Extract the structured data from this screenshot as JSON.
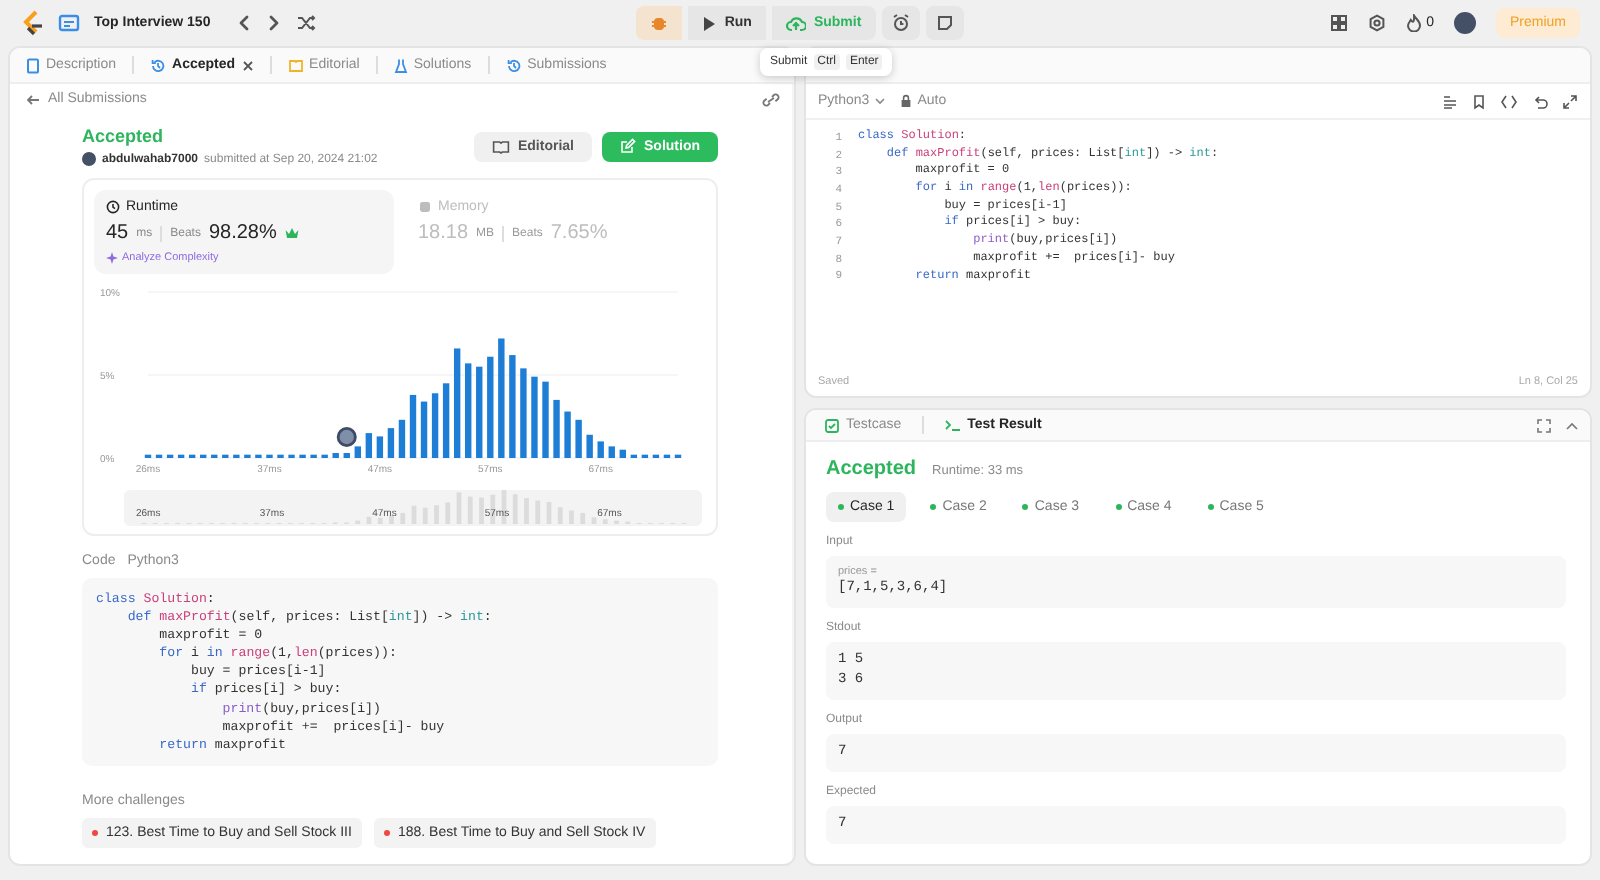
{
  "top_bar": {
    "problem_list_title": "Top Interview 150",
    "run_label": "Run",
    "submit_label": "Submit",
    "streak_count": "0",
    "premium_label": "Premium"
  },
  "submit_tooltip": {
    "label": "Submit",
    "keys": [
      "Ctrl",
      "Enter"
    ]
  },
  "left_tabs": [
    {
      "label": "Description",
      "selected": false,
      "closable": false,
      "kind": "description"
    },
    {
      "label": "Accepted",
      "selected": true,
      "closable": true,
      "kind": "result"
    },
    {
      "label": "Editorial",
      "selected": false,
      "closable": false,
      "kind": "editorial"
    },
    {
      "label": "Solutions",
      "selected": false,
      "closable": false,
      "kind": "solutions"
    },
    {
      "label": "Submissions",
      "selected": false,
      "closable": false,
      "kind": "submissions"
    }
  ],
  "submission": {
    "back_link": "All Submissions",
    "status": "Accepted",
    "username": "abdulwahab7000",
    "submitted_text": "submitted at Sep 20, 2024 21:02",
    "buttons": [
      {
        "label": "Editorial",
        "kind": "secondary"
      },
      {
        "label": "Solution",
        "kind": "primary"
      }
    ],
    "metrics": [
      {
        "title": "Runtime",
        "value": "45",
        "unit": "ms",
        "beats_label": "Beats",
        "beats": "98.28%",
        "selected": true,
        "analyze_link": "Analyze Complexity"
      },
      {
        "title": "Memory",
        "value": "18.18",
        "unit": "MB",
        "beats_label": "Beats",
        "beats": "7.65%",
        "selected": false
      }
    ],
    "chart_data": {
      "type": "bar",
      "ylim": [
        0,
        10
      ],
      "yticks": [
        {
          "value": 0,
          "label": "0%"
        },
        {
          "value": 5,
          "label": "5%"
        },
        {
          "value": 10,
          "label": "10%"
        }
      ],
      "xlim": [
        26,
        74
      ],
      "x": [
        26,
        27,
        28,
        29,
        30,
        31,
        32,
        33,
        34,
        35,
        36,
        37,
        38,
        39,
        40,
        41,
        42,
        43,
        44,
        45,
        46,
        47,
        48,
        49,
        50,
        51,
        52,
        53,
        54,
        55,
        56,
        57,
        58,
        59,
        60,
        61,
        62,
        63,
        64,
        65,
        66,
        67,
        68,
        69,
        70,
        71,
        72,
        73,
        74
      ],
      "xticks": [
        {
          "value": 26,
          "label": "26ms"
        },
        {
          "value": 37,
          "label": "37ms"
        },
        {
          "value": 47,
          "label": "47ms"
        },
        {
          "value": 57,
          "label": "57ms"
        },
        {
          "value": 67,
          "label": "67ms"
        }
      ],
      "series": [
        {
          "color": "#1e7ed6",
          "values": [
            0.2,
            0.2,
            0.2,
            0.2,
            0.2,
            0.2,
            0.2,
            0.2,
            0.2,
            0.2,
            0.2,
            0.2,
            0.2,
            0.2,
            0.2,
            0.2,
            0.2,
            0.3,
            0.3,
            0.7,
            1.5,
            1.3,
            1.8,
            2.3,
            3.8,
            3.4,
            3.9,
            4.5,
            6.6,
            5.7,
            5.5,
            6.1,
            7.2,
            6.2,
            5.4,
            4.9,
            4.6,
            3.5,
            2.8,
            2.3,
            1.4,
            1.0,
            0.7,
            0.5,
            0.2,
            0.2,
            0.2,
            0.2,
            0.2
          ]
        }
      ]
    },
    "navigator_labels": [
      "26ms",
      "37ms",
      "47ms",
      "57ms",
      "67ms"
    ],
    "code_label": "Code",
    "language": "Python3",
    "code": [
      [
        {
          "text": "class",
          "kind": "keyword"
        },
        {
          "text": " Solution",
          "kind": "function"
        },
        {
          "text": ":",
          "kind": "plain"
        }
      ],
      [
        {
          "text": "    def",
          "kind": "keyword"
        },
        {
          "text": " maxProfit",
          "kind": "function"
        },
        {
          "text": "(self, prices: List[",
          "kind": "plain"
        },
        {
          "text": "int",
          "kind": "type"
        },
        {
          "text": "]) -> ",
          "kind": "plain"
        },
        {
          "text": "int",
          "kind": "type"
        },
        {
          "text": ":",
          "kind": "plain"
        }
      ],
      [
        {
          "text": "        maxprofit = 0",
          "kind": "plain"
        }
      ],
      [
        {
          "text": "        for",
          "kind": "keyword"
        },
        {
          "text": " i ",
          "kind": "plain"
        },
        {
          "text": "in",
          "kind": "keyword"
        },
        {
          "text": " range",
          "kind": "function"
        },
        {
          "text": "(1,",
          "kind": "plain"
        },
        {
          "text": "len",
          "kind": "function"
        },
        {
          "text": "(prices)):",
          "kind": "plain"
        }
      ],
      [
        {
          "text": "            buy = prices[i-1]",
          "kind": "plain"
        }
      ],
      [
        {
          "text": "            if",
          "kind": "keyword"
        },
        {
          "text": " prices[i] > buy:",
          "kind": "plain"
        }
      ],
      [
        {
          "text": "                print",
          "kind": "builtin"
        },
        {
          "text": "(buy,prices[i])",
          "kind": "plain"
        }
      ],
      [
        {
          "text": "                maxprofit +=  prices[i]- buy",
          "kind": "plain"
        }
      ],
      [
        {
          "text": "        return",
          "kind": "keyword"
        },
        {
          "text": " maxprofit",
          "kind": "plain"
        }
      ]
    ],
    "more_challenges": {
      "title": "More challenges",
      "items": [
        {
          "label": "123. Best Time to Buy and Sell Stock III",
          "color": "#ef4743"
        },
        {
          "label": "188. Best Time to Buy and Sell Stock IV",
          "color": "#ef4743"
        }
      ]
    }
  },
  "editor": {
    "language": "Python3",
    "autocomplete": "Auto",
    "status": "Saved",
    "cursor": "Ln 8, Col 25",
    "lines": [
      {
        "number": "1",
        "tokens": [
          {
            "text": "class",
            "kind": "keyword"
          },
          {
            "text": " Solution",
            "kind": "function"
          },
          {
            "text": ":",
            "kind": "plain"
          }
        ]
      },
      {
        "number": "2",
        "tokens": [
          {
            "text": "    def",
            "kind": "keyword"
          },
          {
            "text": " maxProfit",
            "kind": "function"
          },
          {
            "text": "(self, prices: List[",
            "kind": "plain"
          },
          {
            "text": "int",
            "kind": "type"
          },
          {
            "text": "]) -> ",
            "kind": "plain"
          },
          {
            "text": "int",
            "kind": "type"
          },
          {
            "text": ":",
            "kind": "plain"
          }
        ]
      },
      {
        "number": "3",
        "tokens": [
          {
            "text": "        maxprofit = 0",
            "kind": "plain"
          }
        ]
      },
      {
        "number": "4",
        "tokens": [
          {
            "text": "        for",
            "kind": "keyword"
          },
          {
            "text": " i ",
            "kind": "plain"
          },
          {
            "text": "in",
            "kind": "keyword"
          },
          {
            "text": " range",
            "kind": "function"
          },
          {
            "text": "(1,",
            "kind": "plain"
          },
          {
            "text": "len",
            "kind": "function"
          },
          {
            "text": "(prices)):",
            "kind": "plain"
          }
        ]
      },
      {
        "number": "5",
        "tokens": [
          {
            "text": "            buy = prices[i-1]",
            "kind": "plain"
          }
        ]
      },
      {
        "number": "6",
        "tokens": [
          {
            "text": "            if",
            "kind": "keyword"
          },
          {
            "text": " prices[i] > buy:",
            "kind": "plain"
          }
        ]
      },
      {
        "number": "7",
        "tokens": [
          {
            "text": "                print",
            "kind": "builtin"
          },
          {
            "text": "(buy,prices[i])",
            "kind": "plain"
          }
        ]
      },
      {
        "number": "8",
        "tokens": [
          {
            "text": "                maxprofit +=  prices[i]- buy",
            "kind": "plain"
          }
        ]
      },
      {
        "number": "9",
        "tokens": [
          {
            "text": "        return",
            "kind": "keyword"
          },
          {
            "text": " maxprofit",
            "kind": "plain"
          }
        ]
      }
    ]
  },
  "test_panel": {
    "tabs": [
      {
        "label": "Testcase",
        "selected": false,
        "kind": "testcase"
      },
      {
        "label": "Test Result",
        "selected": true,
        "kind": "result"
      }
    ],
    "status": "Accepted",
    "runtime": "Runtime: 33 ms",
    "cases": [
      {
        "label": "Case 1",
        "selected": true,
        "passed": true
      },
      {
        "label": "Case 2",
        "selected": false,
        "passed": true
      },
      {
        "label": "Case 3",
        "selected": false,
        "passed": true
      },
      {
        "label": "Case 4",
        "selected": false,
        "passed": true
      },
      {
        "label": "Case 5",
        "selected": false,
        "passed": true
      }
    ],
    "sections": [
      {
        "title": "Input",
        "variable": "prices =",
        "lines": [
          "[7,1,5,3,6,4]"
        ]
      },
      {
        "title": "Stdout",
        "lines": [
          "1 5",
          "3 6"
        ]
      },
      {
        "title": "Output",
        "lines": [
          "7"
        ]
      },
      {
        "title": "Expected",
        "lines": [
          "7"
        ]
      }
    ]
  }
}
